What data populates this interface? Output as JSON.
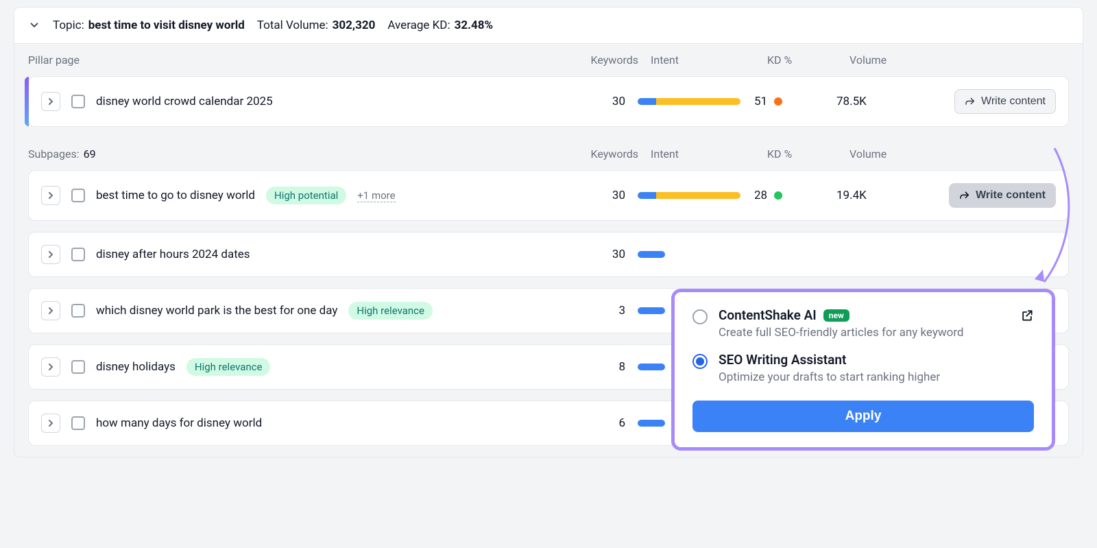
{
  "topic": {
    "label": "Topic:",
    "name": "best time to visit disney world",
    "totalVolumeLabel": "Total Volume:",
    "totalVolume": "302,320",
    "avgKdLabel": "Average KD:",
    "avgKd": "32.48%"
  },
  "columns": {
    "keywords": "Keywords",
    "intent": "Intent",
    "kd": "KD %",
    "volume": "Volume"
  },
  "pillarLabel": "Pillar page",
  "pillar": {
    "title": "disney world crowd calendar 2025",
    "keywords": "30",
    "intentBlue": 18,
    "kd": "51",
    "kdColor": "orange",
    "volume": "78.5K"
  },
  "subpagesLabel": "Subpages:",
  "subpagesCount": "69",
  "rows": [
    {
      "title": "best time to go to disney world",
      "badge": "High potential",
      "badgeClass": "potential",
      "moreText": "+1 more",
      "keywords": "30",
      "intentBlue": 18,
      "intentFull": true,
      "kd": "28",
      "kdColor": "green",
      "volume": "19.4K",
      "writeHighlight": true
    },
    {
      "title": "disney after hours 2024 dates",
      "keywords": "30",
      "intentShort": true
    },
    {
      "title": "which disney world park is the best for one day",
      "badge": "High relevance",
      "badgeClass": "relevance",
      "keywords": "3",
      "intentShort": true
    },
    {
      "title": "disney holidays",
      "badge": "High relevance",
      "badgeClass": "relevance",
      "keywords": "8",
      "intentShort": true
    },
    {
      "title": "how many days for disney world",
      "keywords": "6",
      "intentShort": true
    }
  ],
  "writeLabel": "Write content",
  "popup": {
    "opt1Title": "ContentShake AI",
    "opt1New": "new",
    "opt1Desc": "Create full SEO-friendly articles for any keyword",
    "opt2Title": "SEO Writing Assistant",
    "opt2Desc": "Optimize your drafts to start ranking higher",
    "applyLabel": "Apply"
  }
}
